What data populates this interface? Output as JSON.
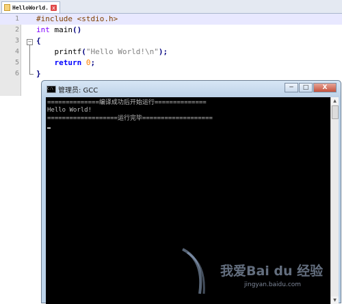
{
  "editor": {
    "tab_label": "HelloWorld.",
    "tab_close": "x",
    "lines": [
      {
        "num": "1",
        "parts": [
          {
            "t": "#include <stdio.h>",
            "c": "kw-pre"
          }
        ]
      },
      {
        "num": "2",
        "parts": [
          {
            "t": "int",
            "c": "kw-type"
          },
          {
            "t": " main",
            "c": "fn"
          },
          {
            "t": "()",
            "c": "op"
          }
        ]
      },
      {
        "num": "3",
        "parts": [
          {
            "t": "{",
            "c": "op"
          }
        ]
      },
      {
        "num": "4",
        "parts": [
          {
            "t": "    printf",
            "c": "fn"
          },
          {
            "t": "(",
            "c": "op"
          },
          {
            "t": "\"Hello World!\\n\"",
            "c": "str"
          },
          {
            "t": ");",
            "c": "op"
          }
        ]
      },
      {
        "num": "5",
        "parts": [
          {
            "t": "    ",
            "c": "fn"
          },
          {
            "t": "return",
            "c": "kw-ret"
          },
          {
            "t": " ",
            "c": "fn"
          },
          {
            "t": "0",
            "c": "num"
          },
          {
            "t": ";",
            "c": "op"
          }
        ]
      },
      {
        "num": "6",
        "parts": [
          {
            "t": "}",
            "c": "op"
          }
        ]
      }
    ]
  },
  "console": {
    "title": "管理员: GCC",
    "buttons": {
      "minimize": "─",
      "maximize": "□",
      "close": "X"
    },
    "output": [
      "==============编译成功后开始运行==============",
      "Hello World!",
      "===================运行完毕===================",
      ""
    ],
    "scroll_up": "▲",
    "scroll_down": "▼"
  },
  "watermark": {
    "brand": "我爱Bai du 经验",
    "url": "jingyan.baidu.com"
  }
}
